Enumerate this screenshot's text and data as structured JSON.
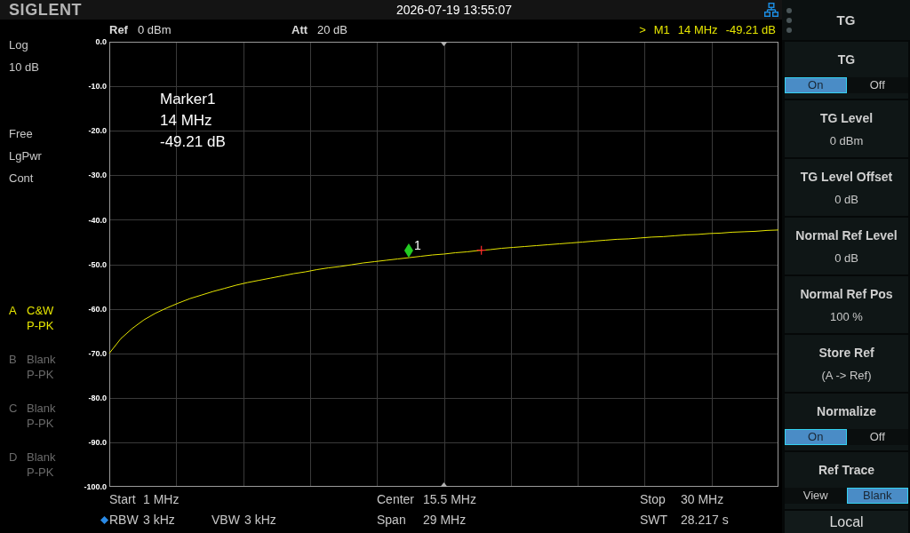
{
  "header": {
    "logo": "SIGLENT",
    "datetime": "2026-07-19 13:55:07"
  },
  "settings_bar": {
    "ref": {
      "label": "Ref",
      "value": "0 dBm"
    },
    "att": {
      "label": "Att",
      "value": "20 dB"
    },
    "marker_readout": {
      "indicator": ">",
      "name": "M1",
      "frequency": "14 MHz",
      "level": "-49.21 dB"
    }
  },
  "left_panel": {
    "scale": [
      "Log",
      "10 dB"
    ],
    "acquisition": [
      "Free",
      "LgPwr",
      "Cont"
    ],
    "traces": [
      {
        "letter": "A",
        "mode": "C&W",
        "detector": "P-PK",
        "active": true
      },
      {
        "letter": "B",
        "mode": "Blank",
        "detector": "P-PK",
        "active": false
      },
      {
        "letter": "C",
        "mode": "Blank",
        "detector": "P-PK",
        "active": false
      },
      {
        "letter": "D",
        "mode": "Blank",
        "detector": "P-PK",
        "active": false
      }
    ]
  },
  "plot": {
    "marker_box": [
      "Marker1",
      "14 MHz",
      "-49.21 dB"
    ],
    "trace_markers": [
      {
        "kind": "diamond",
        "label": "1"
      },
      {
        "kind": "cross"
      }
    ],
    "chart_data": {
      "type": "line",
      "grid": true,
      "categories": [
        null,
        null,
        null,
        null,
        null,
        null,
        null,
        null,
        null,
        null,
        null,
        null,
        null,
        null,
        null,
        null,
        null,
        null,
        null,
        null,
        null,
        null,
        null,
        null,
        null,
        null,
        null,
        null,
        null,
        null,
        null,
        null,
        null,
        null,
        null,
        null,
        null,
        null,
        null,
        null,
        null,
        null,
        null,
        null,
        null,
        null,
        null,
        null,
        null,
        null,
        null,
        null,
        null,
        null,
        null,
        null,
        null,
        null,
        null
      ],
      "series": [
        {
          "color": "#e6e600",
          "values": [
            -70.0,
            -66.7,
            -64.4,
            -62.5,
            -61.0,
            -59.8,
            -58.7,
            -57.7,
            -56.9,
            -56.1,
            -55.4,
            -54.7,
            -54.1,
            -53.6,
            -53.1,
            -52.6,
            -52.1,
            -51.7,
            -51.2,
            -50.8,
            -50.5,
            -50.1,
            -49.7,
            -49.4,
            -49.1,
            -48.8,
            -48.5,
            -48.2,
            -47.9,
            -47.7,
            -47.4,
            -47.2,
            -46.9,
            -46.7,
            -46.4,
            -46.2,
            -46.0,
            -45.8,
            -45.6,
            -45.4,
            -45.2,
            -45.0,
            -44.8,
            -44.6,
            -44.4,
            -44.3,
            -44.1,
            -43.9,
            -43.8,
            -43.6,
            -43.4,
            -43.3,
            -43.1,
            -43.0,
            -42.8,
            -42.7,
            -42.6,
            -42.4,
            -42.3
          ]
        }
      ],
      "ylim": [
        -100,
        0
      ],
      "yticks": [
        {
          "value": 0,
          "label": "0.0"
        },
        {
          "value": -10,
          "label": "-10.0"
        },
        {
          "value": -20,
          "label": "-20.0"
        },
        {
          "value": -30,
          "label": "-30.0"
        },
        {
          "value": -40,
          "label": "-40.0"
        },
        {
          "value": -50,
          "label": "-50.0"
        },
        {
          "value": -60,
          "label": "-60.0"
        },
        {
          "value": -70,
          "label": "-70.0"
        },
        {
          "value": -80,
          "label": "-80.0"
        },
        {
          "value": -90,
          "label": "-90.0"
        },
        {
          "value": -100,
          "label": "-100.0"
        }
      ]
    }
  },
  "bottom_bar": {
    "start": {
      "label": "Start",
      "value": "1 MHz"
    },
    "center": {
      "label": "Center",
      "value": "15.5 MHz"
    },
    "stop": {
      "label": "Stop",
      "value": "30 MHz"
    },
    "rbw": {
      "label": "RBW",
      "value": "3 kHz"
    },
    "vbw": {
      "label": "VBW",
      "value": "3 kHz"
    },
    "span": {
      "label": "Span",
      "value": "29 MHz"
    },
    "swt": {
      "label": "SWT",
      "value": "28.217 s"
    }
  },
  "menu": {
    "title": "TG",
    "softkeys": [
      {
        "kind": "toggle",
        "label": "TG",
        "options": [
          {
            "label": "On",
            "selected": true
          },
          {
            "label": "Off",
            "selected": false
          }
        ]
      },
      {
        "kind": "value",
        "label": "TG Level",
        "value": "0 dBm"
      },
      {
        "kind": "value",
        "label": "TG Level Offset",
        "value": "0 dB"
      },
      {
        "kind": "value",
        "label": "Normal Ref Level",
        "value": "0 dB"
      },
      {
        "kind": "value",
        "label": "Normal Ref Pos",
        "value": "100 %"
      },
      {
        "kind": "value",
        "label": "Store Ref",
        "value": "(A -> Ref)"
      },
      {
        "kind": "toggle",
        "label": "Normalize",
        "options": [
          {
            "label": "On",
            "selected": true
          },
          {
            "label": "Off",
            "selected": false
          }
        ]
      },
      {
        "kind": "toggle",
        "label": "Ref Trace",
        "options": [
          {
            "label": "View",
            "selected": false
          },
          {
            "label": "Blank",
            "selected": true
          }
        ]
      }
    ],
    "local_button": "Local"
  }
}
